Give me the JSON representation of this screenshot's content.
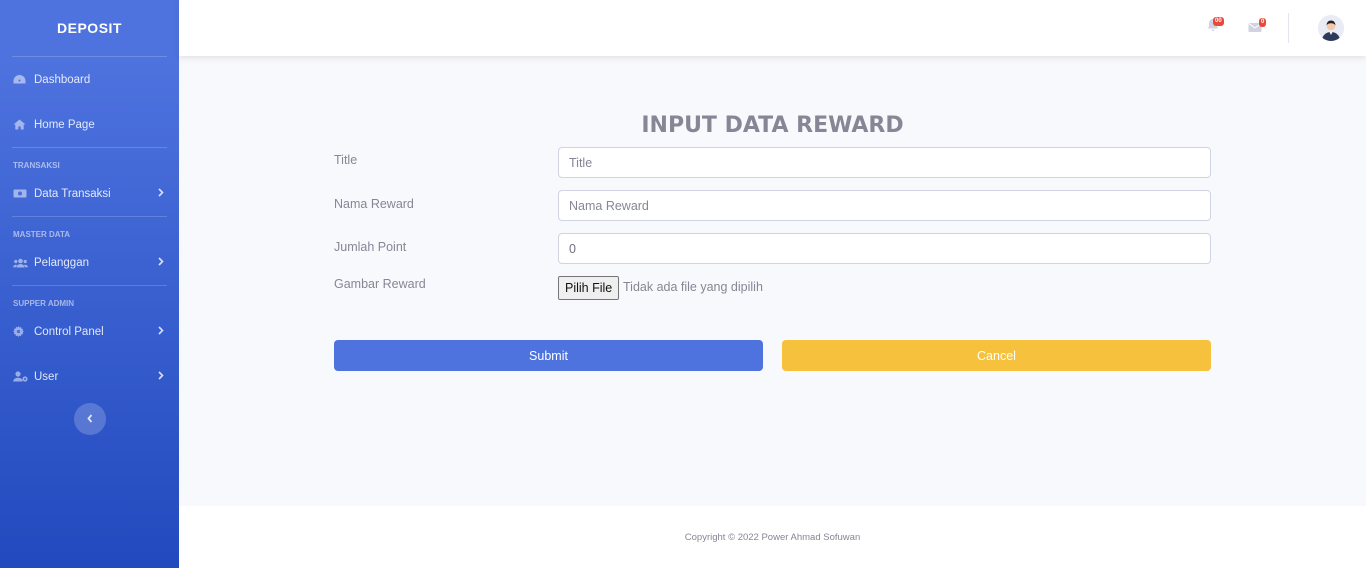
{
  "sidebar": {
    "brand": "DEPOSIT",
    "items": [
      {
        "label": "Dashboard",
        "icon": "tachometer-icon"
      },
      {
        "label": "Home Page",
        "icon": "home-icon"
      },
      {
        "label": "Data Transaksi",
        "icon": "money-bill-icon"
      },
      {
        "label": "Pelanggan",
        "icon": "users-icon"
      },
      {
        "label": "Control Panel",
        "icon": "cog-icon"
      },
      {
        "label": "User",
        "icon": "user-cog-icon"
      }
    ],
    "headings": [
      "TRANSAKSI",
      "MASTER DATA",
      "SUPPER ADMIN"
    ]
  },
  "topbar": {
    "alerts_count": "00",
    "messages_count": "0"
  },
  "form": {
    "title": "INPUT DATA REWARD",
    "fields": {
      "title": {
        "label": "Title",
        "placeholder": "Title",
        "value": ""
      },
      "nama_reward": {
        "label": "Nama Reward",
        "placeholder": "Nama Reward",
        "value": ""
      },
      "jumlah_point": {
        "label": "Jumlah Point",
        "placeholder": "",
        "value": "0"
      },
      "gambar_reward": {
        "label": "Gambar Reward",
        "button": "Pilih File",
        "status": "Tidak ada file yang dipilih"
      }
    },
    "submit_label": "Submit",
    "cancel_label": "Cancel"
  },
  "footer": {
    "copyright": "Copyright © 2022 Power Ahmad Sofuwan"
  },
  "colors": {
    "primary": "#4e73df",
    "warning": "#f6c23e",
    "danger": "#e74a3b",
    "text_muted": "#858796"
  }
}
